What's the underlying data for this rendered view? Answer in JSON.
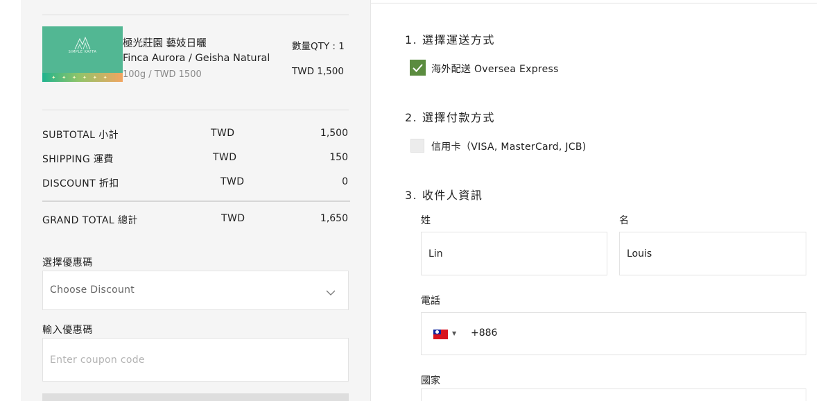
{
  "cart": {
    "product": {
      "name_zh": "極光莊園 藝妓日曬",
      "name_en": "Finca Aurora / Geisha Natural",
      "size_price": "100g / TWD 1500",
      "qty": "數量QTY : 1",
      "price": "TWD 1,500",
      "thumb_brand": "SIMPLE KAFFA",
      "thumb_stars": "✦✦✦✦✦✦"
    },
    "summary": [
      {
        "label": "SUBTOTAL 小計",
        "currency": "TWD",
        "value": "1,500"
      },
      {
        "label": "SHIPPING 運費",
        "currency": "TWD",
        "value": "150"
      },
      {
        "label": "DISCOUNT 折扣",
        "currency": "TWD",
        "value": "0"
      }
    ],
    "grand_total": {
      "label": "GRAND TOTAL 總計",
      "currency": "TWD",
      "value": "1,650"
    },
    "discount_select": {
      "label": "選擇優惠碼",
      "value": "Choose Discount",
      "icon": "chevron-down-icon"
    },
    "coupon": {
      "label": "輸入優惠碼",
      "placeholder": "Enter coupon code"
    }
  },
  "checkout": {
    "shipping": {
      "title": "1. 選擇運送方式",
      "option": "海外配送 Oversea Express",
      "checked": true,
      "check_color": "#5b8c3f"
    },
    "payment": {
      "title": "2. 選擇付款方式",
      "option": "信用卡（VISA, MasterCard, JCB)",
      "checked": false
    },
    "recipient": {
      "title": "3. 收件人資訊",
      "last_name_label": "姓",
      "last_name_value": "Lin",
      "first_name_label": "名",
      "first_name_value": "Louis",
      "phone_label": "電話",
      "phone_flag": "taiwan-flag-icon",
      "phone_code": "+886",
      "country_label": "國家"
    }
  }
}
